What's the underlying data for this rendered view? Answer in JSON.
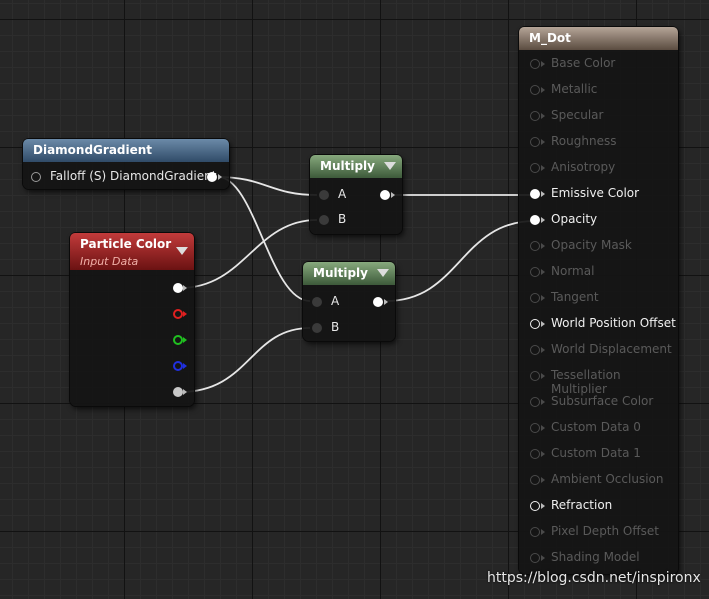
{
  "nodes": {
    "diamond_gradient": {
      "title": "DiamondGradient",
      "output_label": "Falloff (S) DiamondGradient"
    },
    "multiply_top": {
      "title": "Multiply",
      "input_a": "A",
      "input_b": "B"
    },
    "multiply_bottom": {
      "title": "Multiply",
      "input_a": "A",
      "input_b": "B"
    },
    "particle_color": {
      "title": "Particle Color",
      "subtitle": "Input Data"
    },
    "material": {
      "title": "M_Dot",
      "inputs": [
        {
          "label": "Base Color",
          "active": false
        },
        {
          "label": "Metallic",
          "active": false
        },
        {
          "label": "Specular",
          "active": false
        },
        {
          "label": "Roughness",
          "active": false
        },
        {
          "label": "Anisotropy",
          "active": false
        },
        {
          "label": "Emissive Color",
          "active": true,
          "connected": true
        },
        {
          "label": "Opacity",
          "active": true,
          "connected": true
        },
        {
          "label": "Opacity Mask",
          "active": false
        },
        {
          "label": "Normal",
          "active": false
        },
        {
          "label": "Tangent",
          "active": false
        },
        {
          "label": "World Position Offset",
          "active": true,
          "connected": false
        },
        {
          "label": "World Displacement",
          "active": false
        },
        {
          "label": "Tessellation Multiplier",
          "active": false
        },
        {
          "label": "Subsurface Color",
          "active": false
        },
        {
          "label": "Custom Data 0",
          "active": false
        },
        {
          "label": "Custom Data 1",
          "active": false
        },
        {
          "label": "Ambient Occlusion",
          "active": false
        },
        {
          "label": "Refraction",
          "active": true,
          "connected": false
        },
        {
          "label": "Pixel Depth Offset",
          "active": false
        },
        {
          "label": "Shading Model",
          "active": false
        }
      ]
    }
  },
  "watermark": "https://blog.csdn.net/inspironx"
}
